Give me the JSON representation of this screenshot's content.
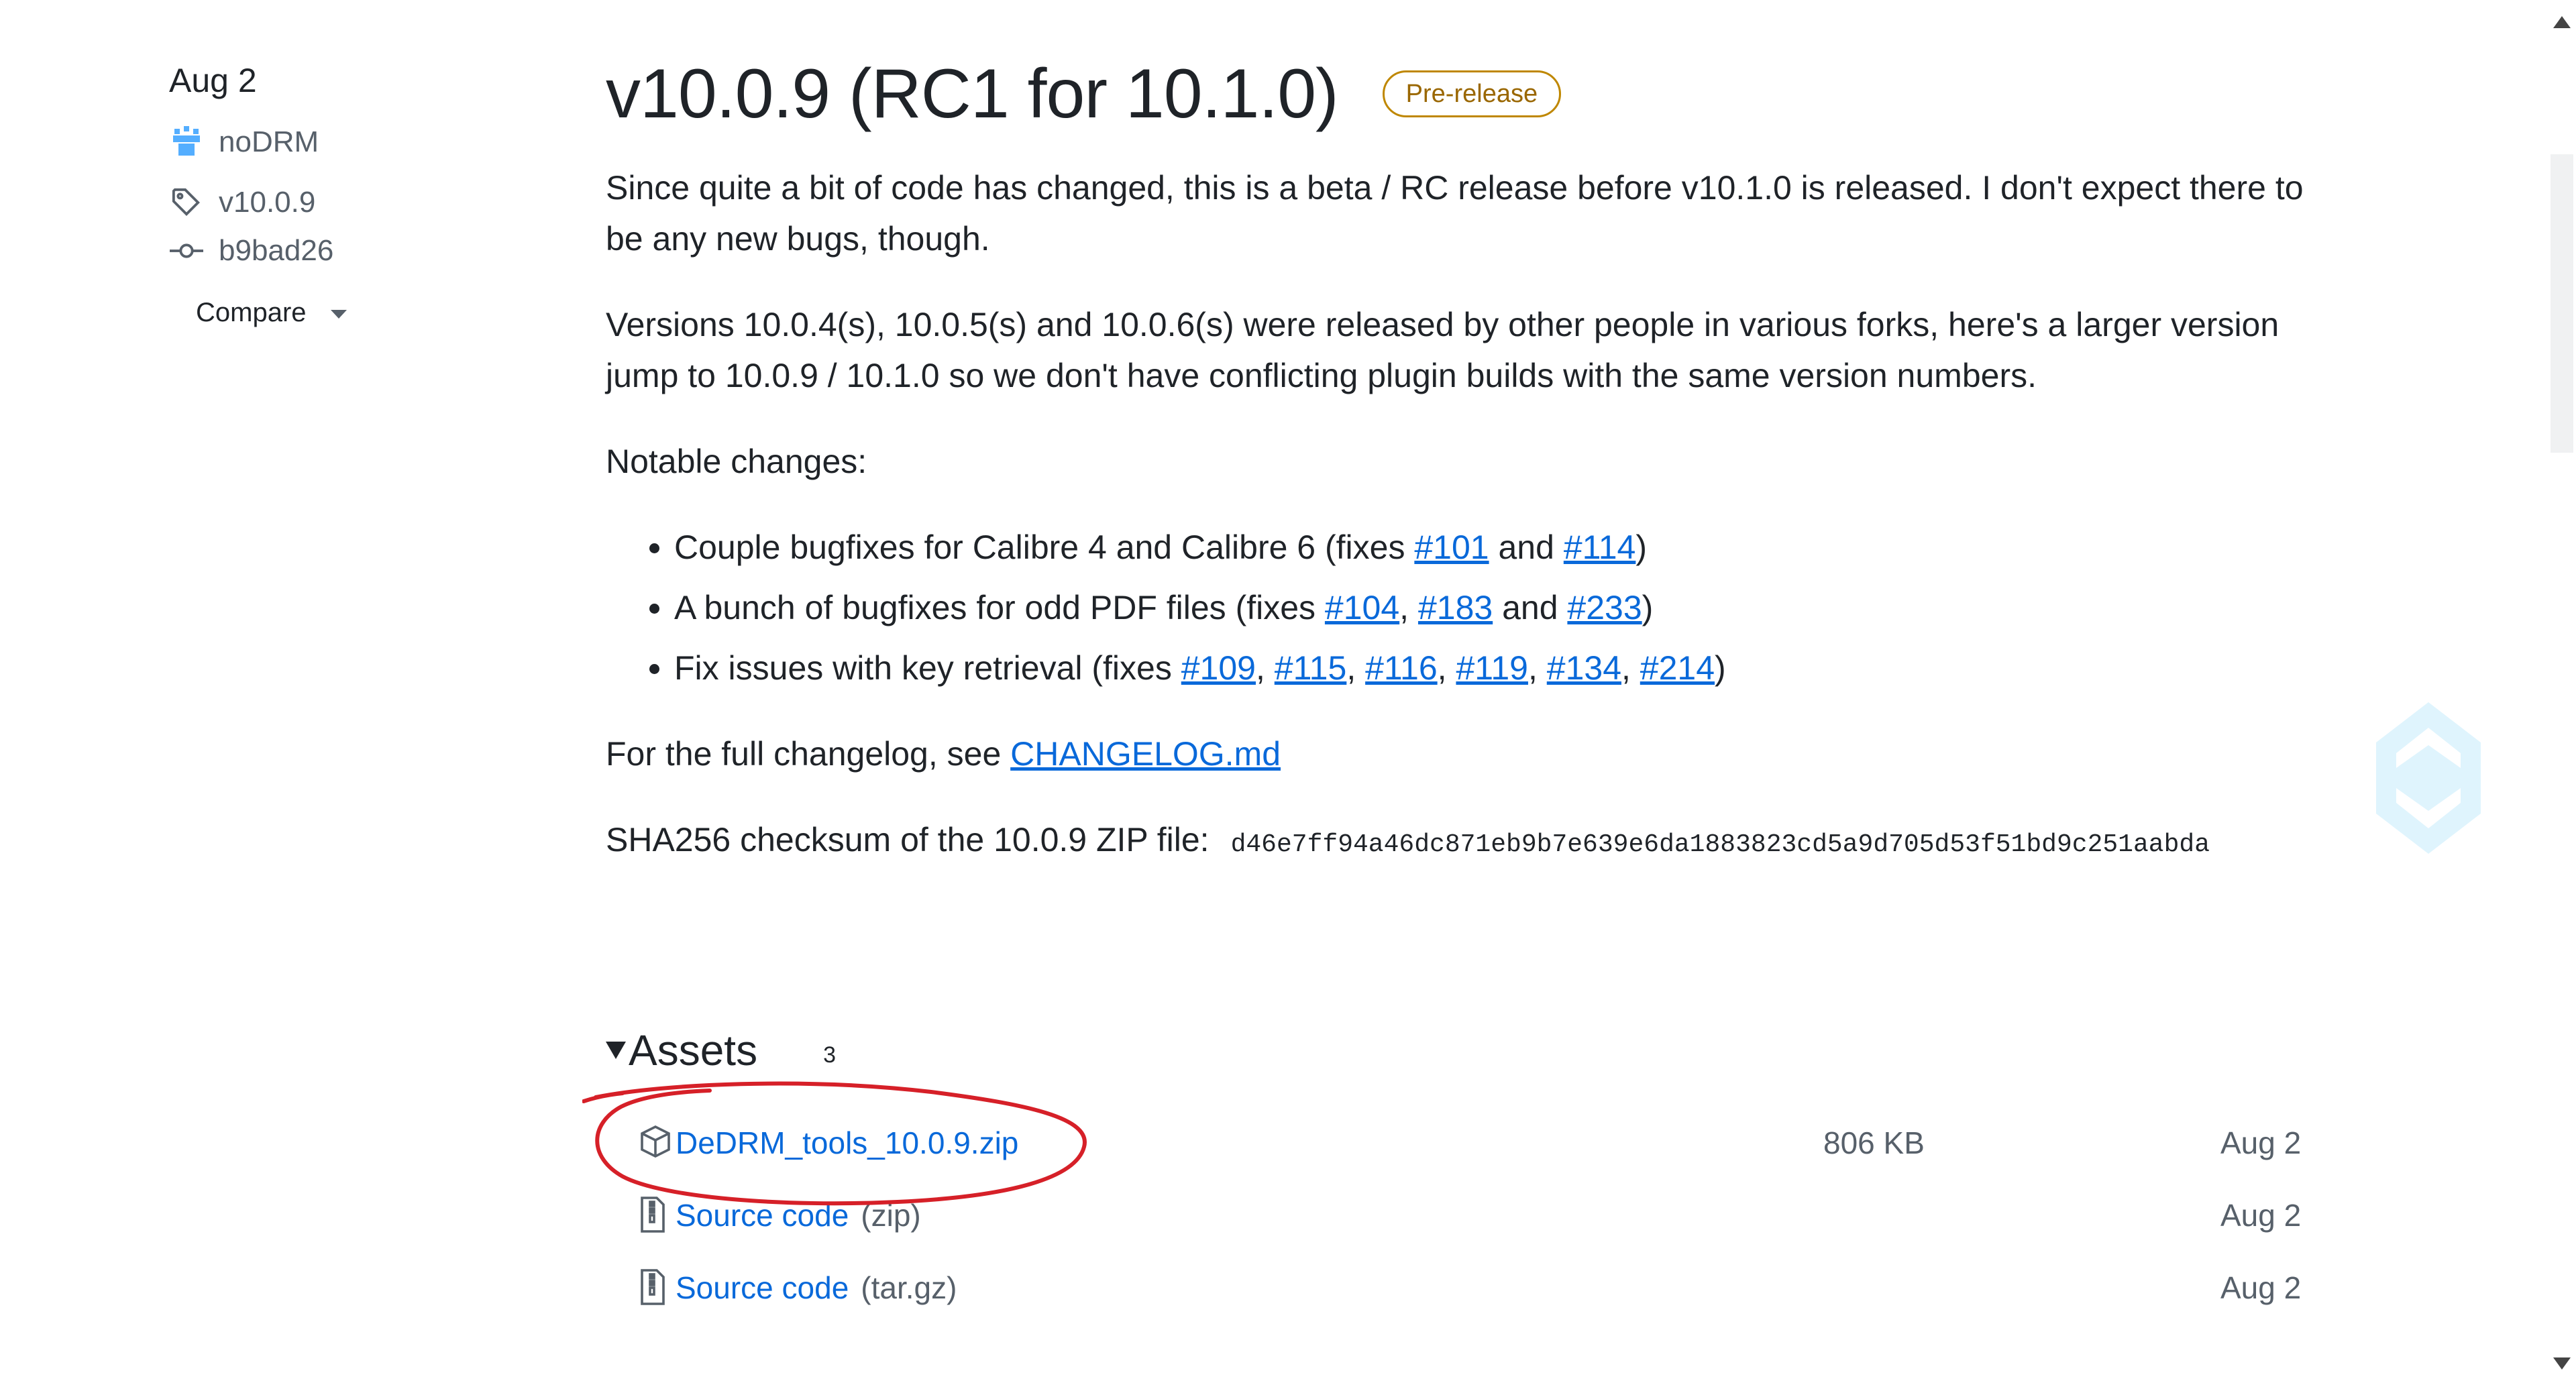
{
  "meta": {
    "date": "Aug 2",
    "author": "noDRM",
    "tag": "v10.0.9",
    "commit": "b9bad26",
    "compare_label": "Compare"
  },
  "release": {
    "title": "v10.0.9 (RC1 for 10.1.0)",
    "badge": "Pre-release",
    "p1": "Since quite a bit of code has changed, this is a beta / RC release before v10.1.0 is released. I don't expect there to be any new bugs, though.",
    "p2": "Versions 10.0.4(s), 10.0.5(s) and 10.0.6(s) were released by other people in various forks, here's a larger version jump to 10.0.9 / 10.1.0 so we don't have conflicting plugin builds with the same version numbers.",
    "notable": "Notable changes:",
    "changes": [
      {
        "text": "Couple bugfixes for Calibre 4 and Calibre 6 (fixes ",
        "issues": [
          "#101",
          "#114"
        ],
        "joiner_last": " and "
      },
      {
        "text": "A bunch of bugfixes for odd PDF files (fixes ",
        "issues": [
          "#104",
          "#183",
          "#233"
        ],
        "joiner_last": " and "
      },
      {
        "text": "Fix issues with key retrieval (fixes ",
        "issues": [
          "#109",
          "#115",
          "#116",
          "#119",
          "#134",
          "#214"
        ],
        "joiner_last": ", "
      }
    ],
    "changelog_prefix": "For the full changelog, see ",
    "changelog_link": "CHANGELOG.md",
    "sha_label": "SHA256 checksum of the 10.0.9 ZIP file:",
    "sha_value": "d46e7ff94a46dc871eb9b7e639e6da1883823cd5a9d705d53f51bd9c251aabda"
  },
  "assets": {
    "title": "Assets",
    "count": "3",
    "items": [
      {
        "name": "DeDRM_tools_10.0.9.zip",
        "sub": "",
        "size": "806 KB",
        "date": "Aug 2",
        "icon": "package-icon"
      },
      {
        "name": "Source code",
        "sub": "(zip)",
        "size": "",
        "date": "Aug 2",
        "icon": "file-zip-icon"
      },
      {
        "name": "Source code",
        "sub": "(tar.gz)",
        "size": "",
        "date": "Aug 2",
        "icon": "file-zip-icon"
      }
    ]
  },
  "colors": {
    "link": "#0969da",
    "badge": "#9a6700",
    "highlight": "#d62028"
  }
}
